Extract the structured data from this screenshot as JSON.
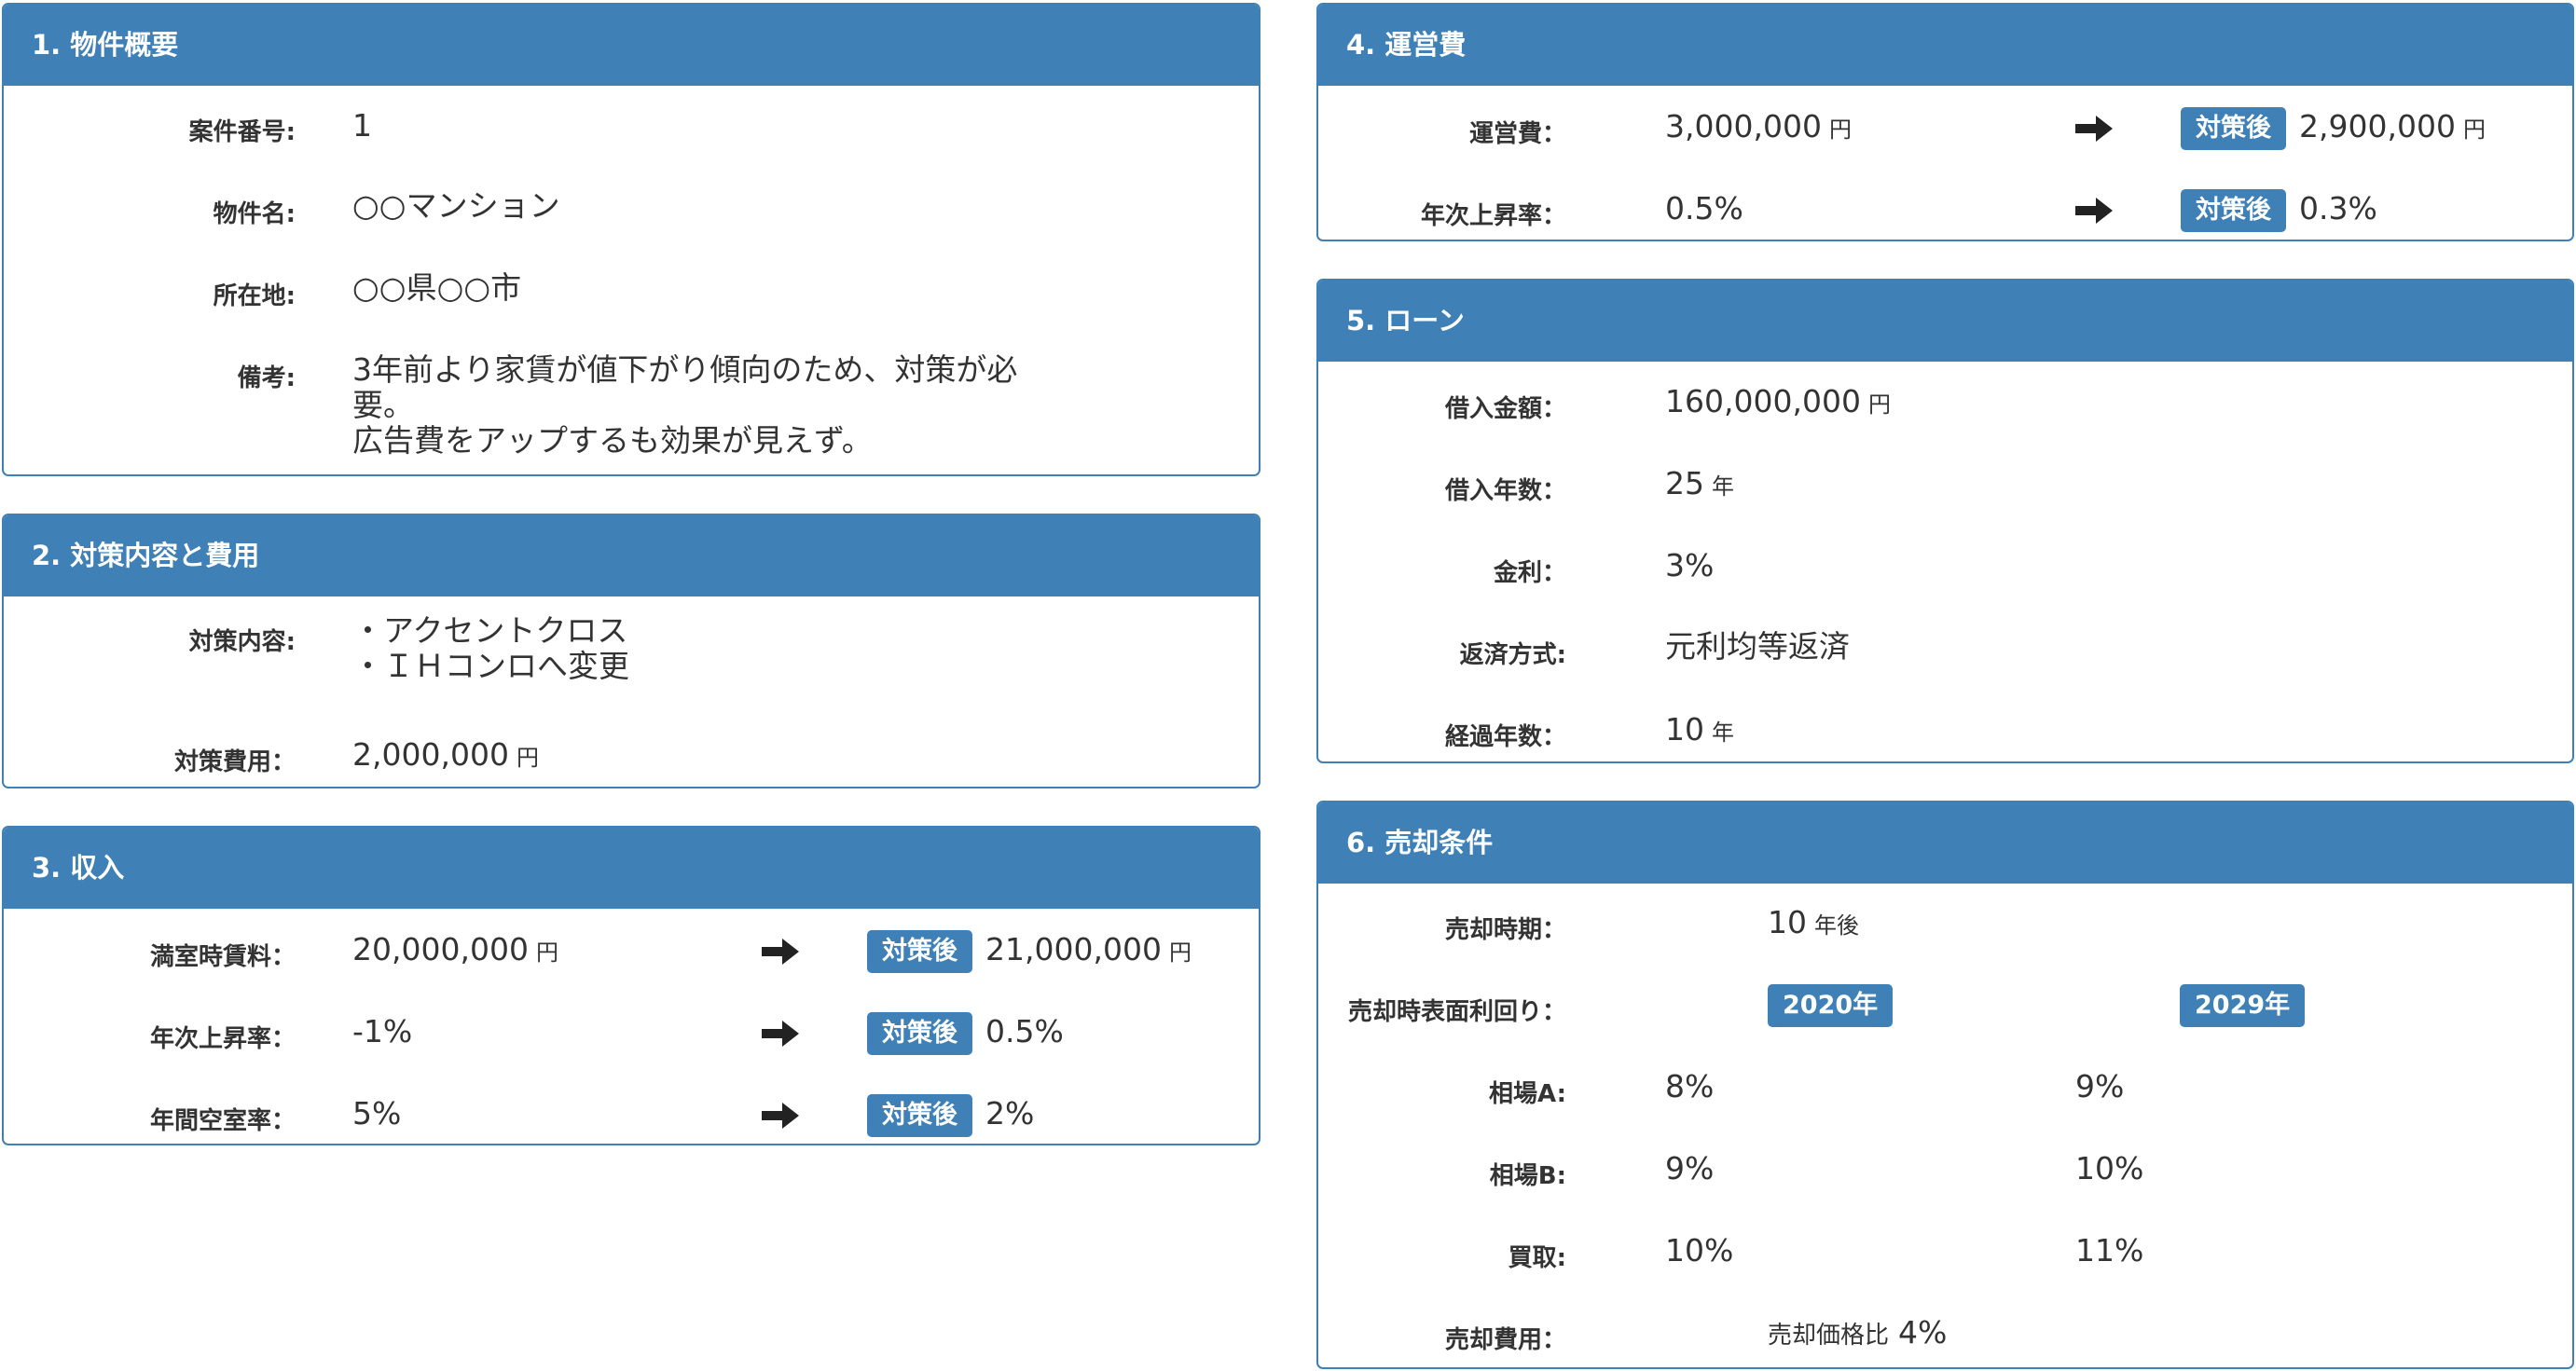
{
  "p1": {
    "title": "1. 物件概要",
    "rows": [
      {
        "label": "案件番号:",
        "value": "1"
      },
      {
        "label": "物件名:",
        "value": "○○マンション"
      },
      {
        "label": "所在地:",
        "value": "○○県○○市"
      },
      {
        "label": "備考:",
        "lines": [
          "3年前より家賃が値下がり傾向のため、対策が必",
          "要。",
          "広告費をアップするも効果が見えず。"
        ]
      }
    ]
  },
  "p2": {
    "title": "2. 対策内容と費用",
    "content_label": "対策内容:",
    "content_lines": [
      "・アクセントクロス",
      "・ＩＨコンロへ変更"
    ],
    "cost_label": "対策費用：",
    "cost_value": "2,000,000",
    "cost_unit": "円"
  },
  "p3": {
    "title": "3. 収入",
    "after_badge": "対策後",
    "rows": [
      {
        "label": "満室時賃料：",
        "value": "20,000,000",
        "unit": "円",
        "after": "21,000,000",
        "after_unit": "円"
      },
      {
        "label": "年次上昇率：",
        "value": "-1%",
        "unit": "",
        "after": "0.5%",
        "after_unit": ""
      },
      {
        "label": "年間空室率：",
        "value": "5%",
        "unit": "",
        "after": "2%",
        "after_unit": ""
      }
    ]
  },
  "p4": {
    "title": "4. 運営費",
    "after_badge": "対策後",
    "rows": [
      {
        "label": "運営費：",
        "value": "3,000,000",
        "unit": "円",
        "after": "2,900,000",
        "after_unit": "円"
      },
      {
        "label": "年次上昇率：",
        "value": "0.5%",
        "unit": "",
        "after": "0.3%",
        "after_unit": ""
      }
    ]
  },
  "p5": {
    "title": "5. ローン",
    "rows": [
      {
        "label": "借入金額：",
        "value": "160,000,000",
        "unit": "円"
      },
      {
        "label": "借入年数：",
        "value": "25",
        "unit": "年"
      },
      {
        "label": "金利：",
        "value": "3%",
        "unit": ""
      },
      {
        "label": "返済方式:",
        "value": "元利均等返済",
        "unit": ""
      },
      {
        "label": "経過年数：",
        "value": "10",
        "unit": "年"
      }
    ]
  },
  "p6": {
    "title": "6. 売却条件",
    "period_label": "売却時期：",
    "period_value": "10",
    "period_unit": "年後",
    "yield_label": "売却時表面利回り：",
    "year_a": "2020年",
    "year_b": "2029年",
    "rows": [
      {
        "label": "相場A:",
        "a": "8%",
        "b": "9%"
      },
      {
        "label": "相場B:",
        "a": "9%",
        "b": "10%"
      },
      {
        "label": "買取:",
        "a": "10%",
        "b": "11%"
      }
    ],
    "cost_label": "売却費用：",
    "cost_prefix": "売却価格比",
    "cost_value": "4%"
  },
  "colors": {
    "primary": "#3f80b6",
    "text": "#333333"
  },
  "icons": {
    "arrow": "arrow-right-icon"
  }
}
